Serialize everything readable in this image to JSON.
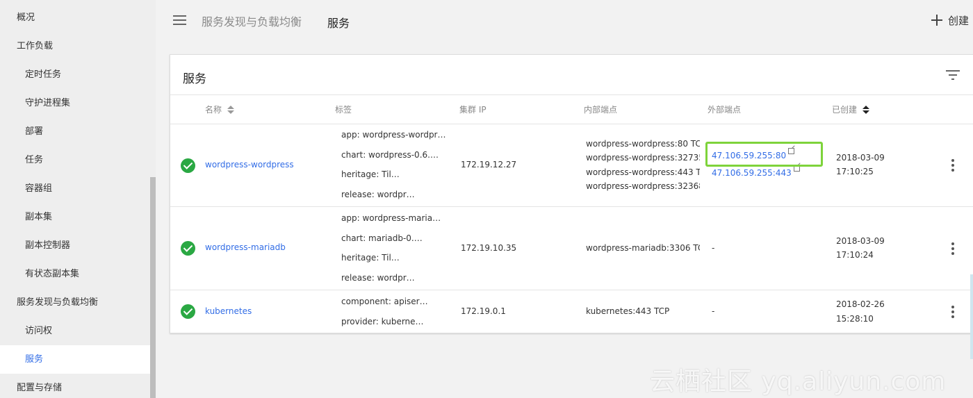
{
  "sidebar": {
    "items": [
      {
        "label": "概况",
        "level": "top"
      },
      {
        "label": "工作负载",
        "level": "top"
      },
      {
        "label": "定时任务",
        "level": "sub"
      },
      {
        "label": "守护进程集",
        "level": "sub"
      },
      {
        "label": "部署",
        "level": "sub"
      },
      {
        "label": "任务",
        "level": "sub"
      },
      {
        "label": "容器组",
        "level": "sub"
      },
      {
        "label": "副本集",
        "level": "sub"
      },
      {
        "label": "副本控制器",
        "level": "sub"
      },
      {
        "label": "有状态副本集",
        "level": "sub"
      },
      {
        "label": "服务发现与负载均衡",
        "level": "top"
      },
      {
        "label": "访问权",
        "level": "sub"
      },
      {
        "label": "服务",
        "level": "sub",
        "active": true
      },
      {
        "label": "配置与存储",
        "level": "top"
      }
    ]
  },
  "toolbar": {
    "menu_icon": "hamburger-menu-icon",
    "breadcrumb_parent": "服务发现与负载均衡",
    "breadcrumb_current": "服务",
    "create_label": "创建",
    "create_icon": "plus-icon"
  },
  "card": {
    "title": "服务",
    "filter_icon": "filter-icon",
    "columns": {
      "name": "名称",
      "labels": "标签",
      "cluster_ip": "集群 IP",
      "internal_endpoints": "内部端点",
      "external_endpoints": "外部端点",
      "created": "已创建"
    }
  },
  "services": [
    {
      "status_icon": "check-circle-icon",
      "name": "wordpress-wordpress",
      "labels": [
        "app: wordpress-wordpr…",
        "chart: wordpress-0.6.…",
        "heritage: Til…",
        "release: wordpr…"
      ],
      "cluster_ip": "172.19.12.27",
      "internal": [
        "wordpress-wordpress:80 TCP",
        "wordpress-wordpress:32735",
        "wordpress-wordpress:443 TC",
        "wordpress-wordpress:32368"
      ],
      "external": [
        "47.106.59.255:80",
        "47.106.59.255:443"
      ],
      "created_date": "2018-03-09",
      "created_time": "17:10:25"
    },
    {
      "status_icon": "check-circle-icon",
      "name": "wordpress-mariadb",
      "labels": [
        "app: wordpress-maria…",
        "chart: mariadb-0.…",
        "heritage: Til…",
        "release: wordpr…"
      ],
      "cluster_ip": "172.19.10.35",
      "internal": [
        "wordpress-mariadb:3306 TCP"
      ],
      "external_text": "-",
      "created_date": "2018-03-09",
      "created_time": "17:10:24"
    },
    {
      "status_icon": "check-circle-icon",
      "name": "kubernetes",
      "labels": [
        "component: apiser…",
        "provider: kuberne…"
      ],
      "cluster_ip": "172.19.0.1",
      "internal": [
        "kubernetes:443 TCP"
      ],
      "external_text": "-",
      "created_date": "2018-02-26",
      "created_time": "15:28:10"
    }
  ],
  "highlight_color": "#7ed33b",
  "link_color": "#326de6",
  "watermark": "云栖社区 yq.aliyun.com"
}
